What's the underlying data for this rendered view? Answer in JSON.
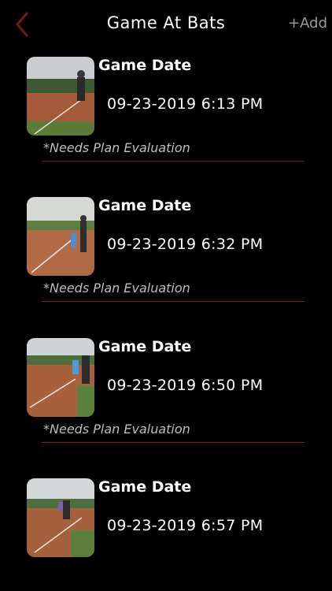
{
  "header": {
    "title": "Game At Bats",
    "add_label": "+Add",
    "accent_color": "#7a1520"
  },
  "entries": [
    {
      "label": "Game Date",
      "datetime": "09-23-2019 6:13 PM",
      "note": "*Needs Plan Evaluation"
    },
    {
      "label": "Game Date",
      "datetime": "09-23-2019 6:32 PM",
      "note": "*Needs Plan Evaluation"
    },
    {
      "label": "Game Date",
      "datetime": "09-23-2019 6:50 PM",
      "note": "*Needs Plan Evaluation"
    },
    {
      "label": "Game Date",
      "datetime": "09-23-2019 6:57 PM"
    }
  ]
}
